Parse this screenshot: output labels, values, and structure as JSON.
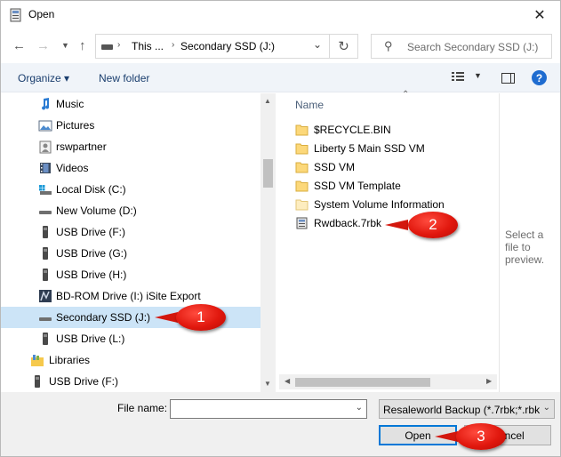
{
  "window": {
    "title": "Open",
    "close_glyph": "✕"
  },
  "address": {
    "crumbs": [
      "This ...",
      "Secondary SSD (J:)"
    ],
    "search_placeholder": "Search Secondary SSD (J:)"
  },
  "toolbar": {
    "organize": "Organize ▾",
    "new_folder": "New folder"
  },
  "nav": {
    "items": [
      {
        "label": "Music",
        "icon": "music-icon"
      },
      {
        "label": "Pictures",
        "icon": "pictures-icon"
      },
      {
        "label": "rswpartner",
        "icon": "user-folder-icon"
      },
      {
        "label": "Videos",
        "icon": "videos-icon"
      },
      {
        "label": "Local Disk (C:)",
        "icon": "system-drive-icon"
      },
      {
        "label": "New Volume (D:)",
        "icon": "drive-icon"
      },
      {
        "label": "USB Drive (F:)",
        "icon": "usb-drive-icon"
      },
      {
        "label": "USB Drive (G:)",
        "icon": "usb-drive-icon"
      },
      {
        "label": "USB Drive (H:)",
        "icon": "usb-drive-icon"
      },
      {
        "label": "BD-ROM Drive (I:) iSite Export",
        "icon": "bd-rom-icon"
      },
      {
        "label": "Secondary SSD (J:)",
        "icon": "drive-icon",
        "selected": true
      },
      {
        "label": "USB Drive (L:)",
        "icon": "usb-drive-icon"
      },
      {
        "label": "Libraries",
        "icon": "libraries-icon"
      },
      {
        "label": "USB Drive (F:)",
        "icon": "usb-drive-icon"
      }
    ]
  },
  "file_list": {
    "column_header": "Name",
    "items": [
      {
        "name": "$RECYCLE.BIN",
        "type": "folder"
      },
      {
        "name": "Liberty 5 Main SSD VM",
        "type": "folder"
      },
      {
        "name": "SSD VM",
        "type": "folder"
      },
      {
        "name": "SSD VM Template",
        "type": "folder"
      },
      {
        "name": "System Volume Information",
        "type": "folder"
      },
      {
        "name": "Rwdback.7rbk",
        "type": "file"
      }
    ]
  },
  "preview": {
    "text": "Select a file to preview."
  },
  "footer": {
    "file_name_label": "File name:",
    "file_name_value": "",
    "file_type": "Resaleworld Backup (*.7rbk;*.rbk",
    "open_label": "Open",
    "cancel_label": "Cancel"
  },
  "callouts": [
    "1",
    "2",
    "3"
  ],
  "colors": {
    "selection": "#cce4f7",
    "callout_red": "#e1180e",
    "default_button_border": "#0078d7",
    "link_blue": "#1a3e6e"
  }
}
